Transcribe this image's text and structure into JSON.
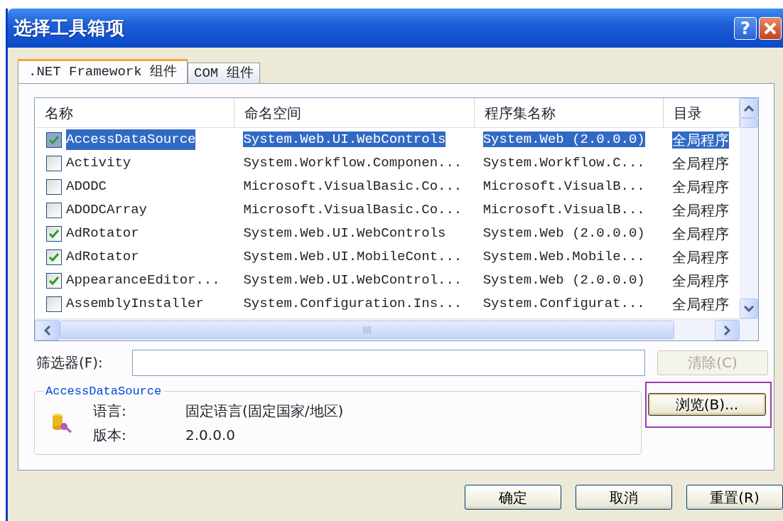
{
  "window": {
    "title": "选择工具箱项",
    "help_button": "?"
  },
  "tabs": [
    {
      "label": ".NET Framework 组件",
      "selected": true
    },
    {
      "label": "COM 组件",
      "selected": false
    }
  ],
  "table": {
    "columns": [
      "名称",
      "命名空间",
      "程序集名称",
      "目录"
    ],
    "rows": [
      {
        "checked": true,
        "selected": true,
        "cells": [
          "AccessDataSource",
          "System.Web.UI.WebControls",
          "System.Web (2.0.0.0)",
          "全局程序"
        ]
      },
      {
        "checked": false,
        "selected": false,
        "cells": [
          "Activity",
          "System.Workflow.Componen...",
          "System.Workflow.C...",
          "全局程序"
        ]
      },
      {
        "checked": false,
        "selected": false,
        "cells": [
          "ADODC",
          "Microsoft.VisualBasic.Co...",
          "Microsoft.VisualB...",
          "全局程序"
        ]
      },
      {
        "checked": false,
        "selected": false,
        "cells": [
          "ADODCArray",
          "Microsoft.VisualBasic.Co...",
          "Microsoft.VisualB...",
          "全局程序"
        ]
      },
      {
        "checked": true,
        "selected": false,
        "cells": [
          "AdRotator",
          "System.Web.UI.WebControls",
          "System.Web (2.0.0.0)",
          "全局程序"
        ]
      },
      {
        "checked": true,
        "selected": false,
        "cells": [
          "AdRotator",
          "System.Web.UI.MobileCont...",
          "System.Web.Mobile...",
          "全局程序"
        ]
      },
      {
        "checked": true,
        "selected": false,
        "cells": [
          "AppearanceEditor...",
          "System.Web.UI.WebControl...",
          "System.Web (2.0.0.0)",
          "全局程序"
        ]
      },
      {
        "checked": false,
        "selected": false,
        "cells": [
          "AssemblyInstaller",
          "System.Configuration.Ins...",
          "System.Configurat...",
          "全局程序"
        ]
      }
    ]
  },
  "filter": {
    "label": "筛选器(F):",
    "clear_button": {
      "label": "清除(C)",
      "disabled": true
    }
  },
  "details": {
    "legend": "AccessDataSource",
    "fields": [
      {
        "label": "语言:",
        "value": "固定语言(固定国家/地区)"
      },
      {
        "label": "版本:",
        "value": "2.0.0.0"
      }
    ]
  },
  "browse_button": {
    "label": "浏览(B)...",
    "highlighted": true
  },
  "buttons": [
    "确定",
    "取消",
    "重置(R)"
  ]
}
